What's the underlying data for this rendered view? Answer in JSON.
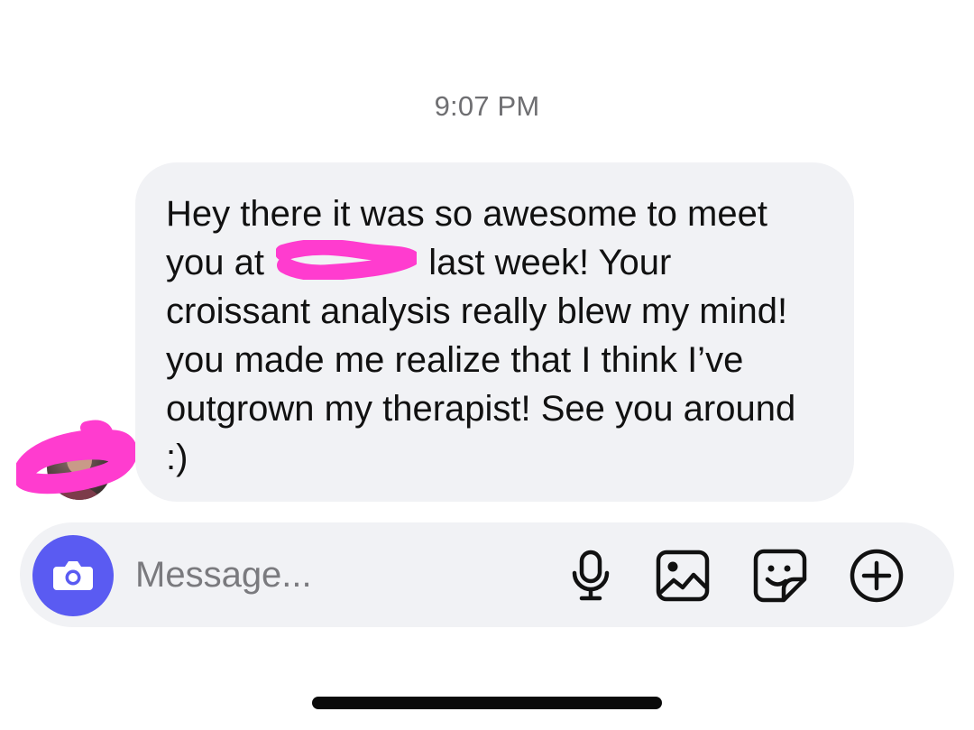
{
  "thread": {
    "timestamp": "9:07 PM"
  },
  "message": {
    "sender": "other",
    "text_before_redaction": "Hey there it was so awesome to meet you at",
    "text_after_redaction": "last week! Your croissant analysis really blew my mind! you made me realize that I think I’ve outgrown my therapist! See you around :)",
    "redaction_color": "#ff3ccf"
  },
  "composer": {
    "placeholder": "Message...",
    "accent_color": "#5a5bf2",
    "buttons": [
      {
        "icon": "camera-icon"
      },
      {
        "icon": "microphone-icon"
      },
      {
        "icon": "image-icon"
      },
      {
        "icon": "sticker-icon"
      },
      {
        "icon": "plus-circle-icon"
      }
    ]
  },
  "colors": {
    "bubble_background": "#f1f2f5",
    "timestamp_text": "#6f6f72",
    "home_indicator": "#0a0a0a"
  }
}
